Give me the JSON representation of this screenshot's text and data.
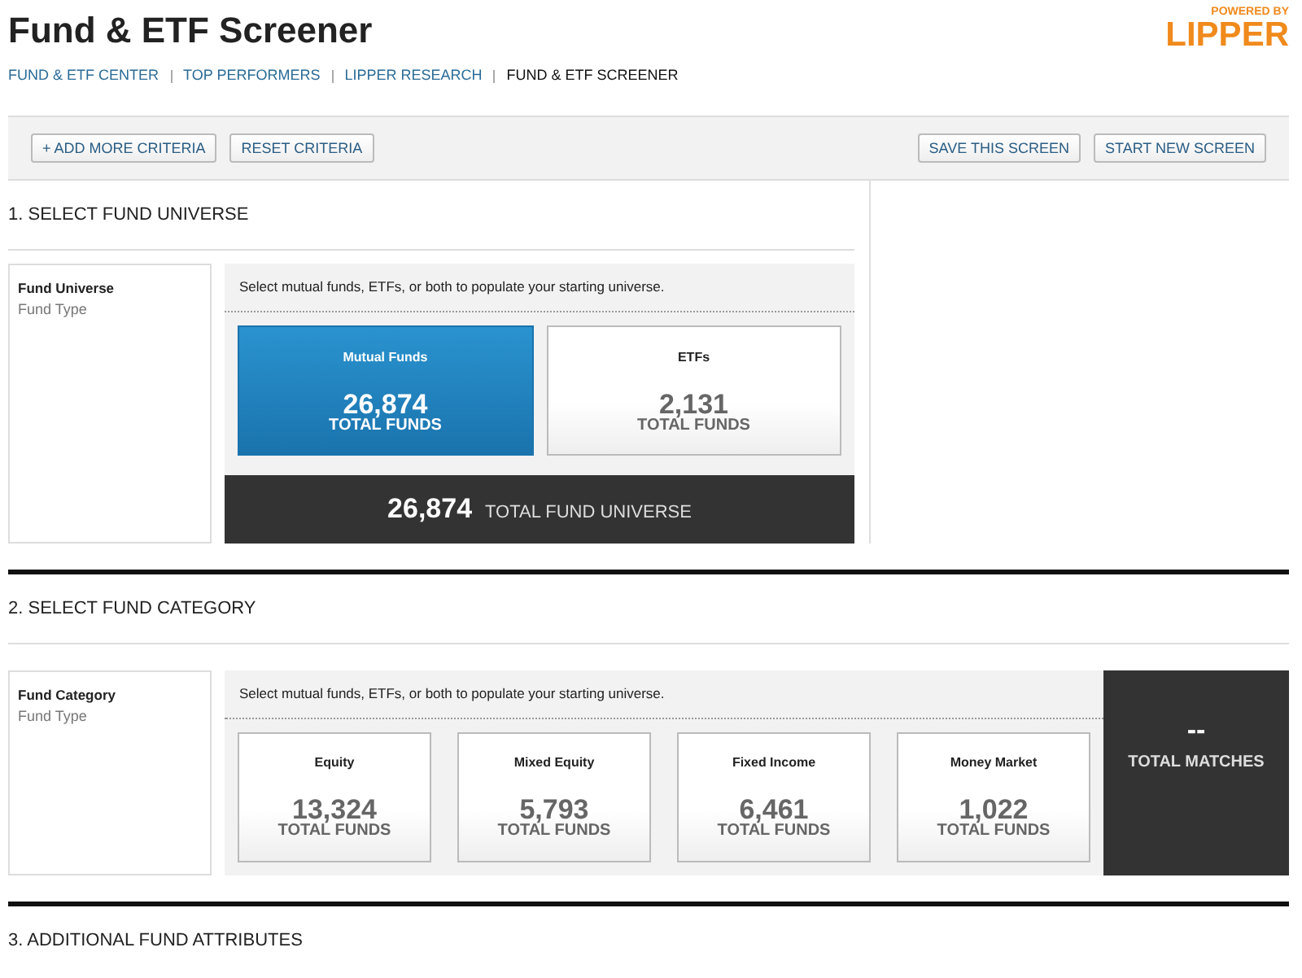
{
  "header": {
    "title": "Fund & ETF Screener",
    "powered_by": "POWERED BY",
    "logo": "LIPPER"
  },
  "breadcrumb": [
    {
      "label": "FUND & ETF CENTER",
      "selected": false
    },
    {
      "label": "TOP PERFORMERS",
      "selected": false
    },
    {
      "label": "LIPPER RESEARCH",
      "selected": false
    },
    {
      "label": "FUND & ETF SCREENER",
      "selected": true
    }
  ],
  "toolbar": {
    "left_buttons": [
      "+ ADD MORE CRITERIA",
      "RESET CRITERIA"
    ],
    "right_buttons": [
      "SAVE THIS SCREEN",
      "START NEW SCREEN"
    ]
  },
  "sections": [
    {
      "heading": "1. SELECT FUND UNIVERSE",
      "kind": "universe",
      "side_title": "Fund Universe",
      "side_subtitle": "Fund Type",
      "instruction": "Select mutual funds, ETFs, or both to populate your starting universe.",
      "options": [
        {
          "label": "Mutual Funds",
          "count": "26,874",
          "unit": "TOTAL FUNDS",
          "selected": true
        },
        {
          "label": "ETFs",
          "count": "2,131",
          "unit": "TOTAL FUNDS",
          "selected": false
        }
      ],
      "total": {
        "count": "26,874",
        "label": "TOTAL FUND UNIVERSE"
      }
    },
    {
      "heading": "2. SELECT FUND CATEGORY",
      "kind": "category",
      "side_title": "Fund Category",
      "side_subtitle": "Fund Type",
      "instruction": "Select mutual funds, ETFs, or both to populate your starting universe.",
      "options": [
        {
          "label": "Equity",
          "count": "13,324",
          "unit": "TOTAL FUNDS",
          "selected": false
        },
        {
          "label": "Mixed Equity",
          "count": "5,793",
          "unit": "TOTAL FUNDS",
          "selected": false
        },
        {
          "label": "Fixed Income",
          "count": "6,461",
          "unit": "TOTAL FUNDS",
          "selected": false
        },
        {
          "label": "Money Market",
          "count": "1,022",
          "unit": "TOTAL FUNDS",
          "selected": false
        }
      ],
      "total": {
        "count": "--",
        "label": "TOTAL MATCHES"
      }
    },
    {
      "heading": "3. ADDITIONAL FUND ATTRIBUTES",
      "kind": "heading_only"
    }
  ]
}
